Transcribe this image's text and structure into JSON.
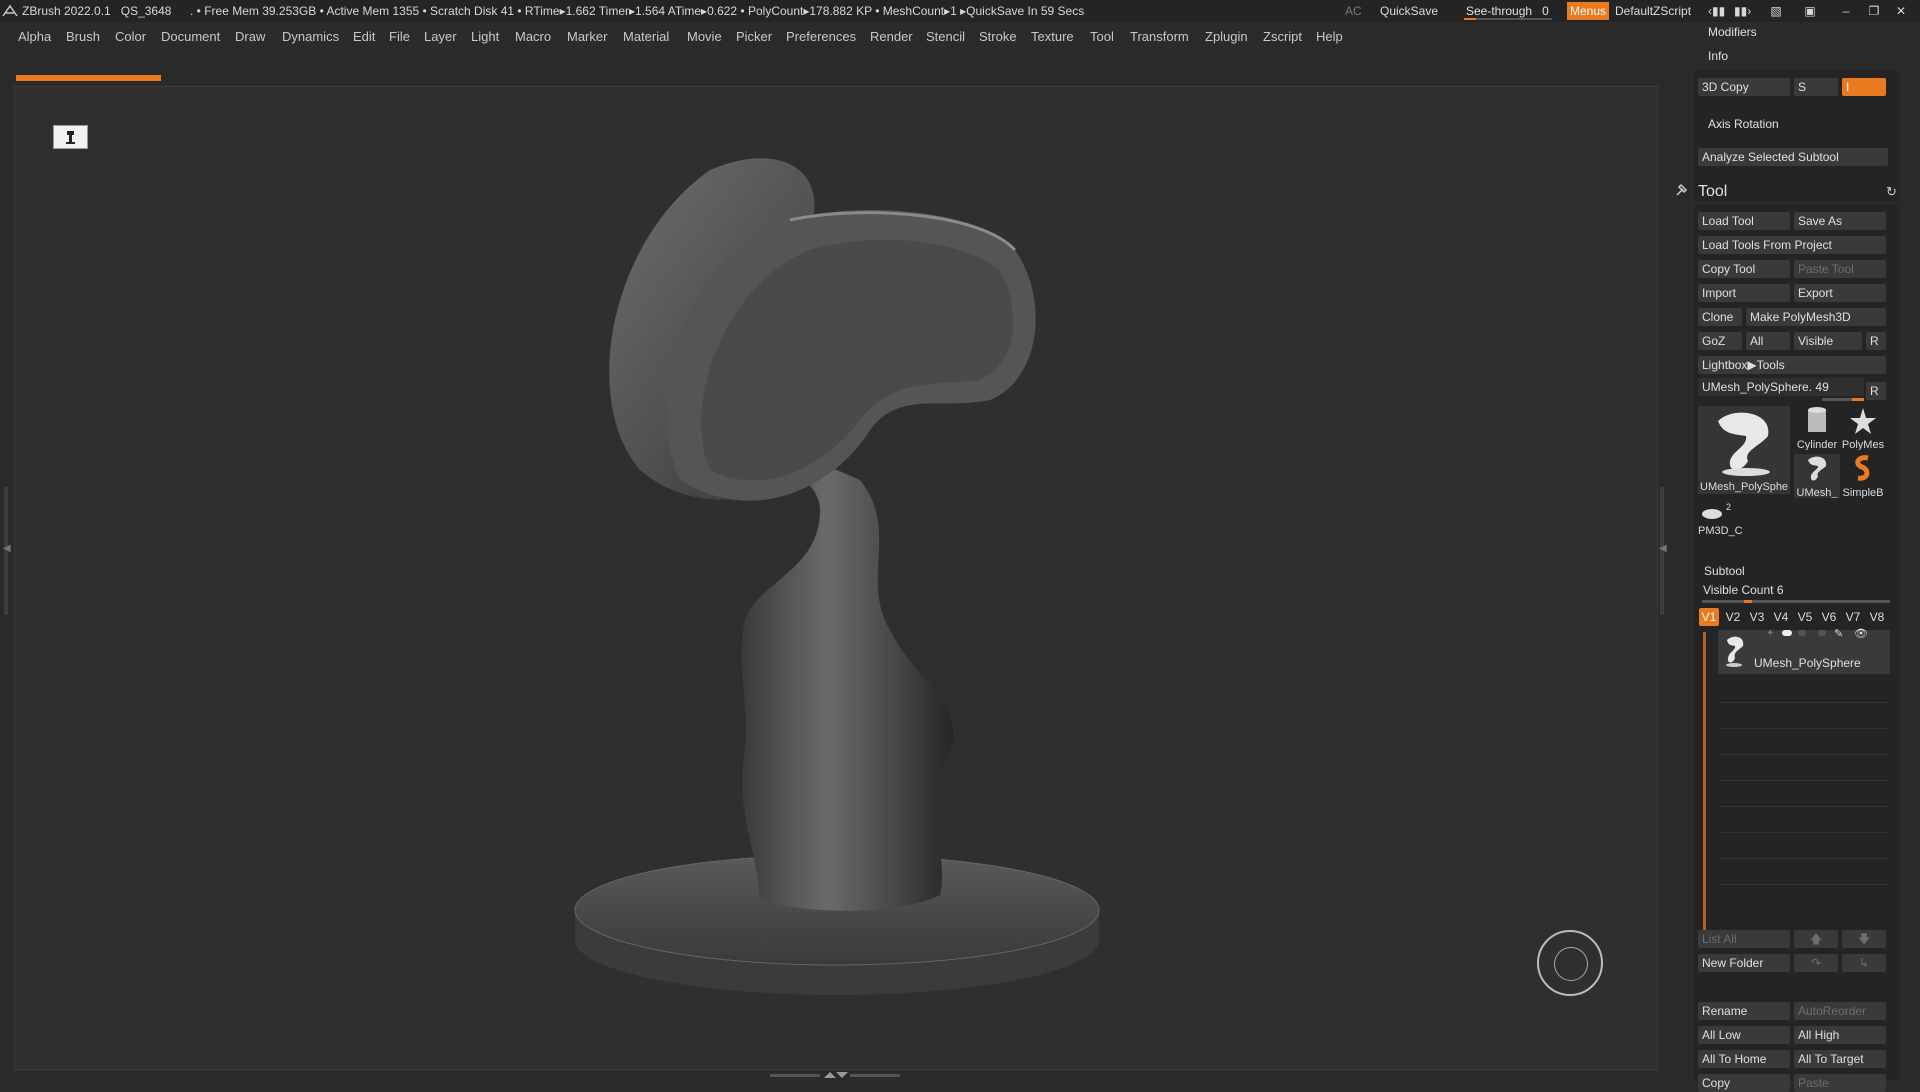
{
  "titlebar": {
    "app": "ZBrush 2022.0.1",
    "project": "QS_3648",
    "stats": ". • Free Mem 39.253GB • Active Mem 1355 • Scratch Disk 41 •  RTime▸1.662 Timer▸1.564 ATime▸0.622 • PolyCount▸178.882 KP  • MeshCount▸1  ▸QuickSave In 59 Secs",
    "ac": "AC",
    "quicksave": "QuickSave",
    "seethrough_label": "See-through",
    "seethrough_value": "0",
    "seethrough_level": 0.0,
    "menus": "Menus",
    "script": "DefaultZScript"
  },
  "menubar": [
    "Alpha",
    "Brush",
    "Color",
    "Document",
    "Draw",
    "Dynamics",
    "Edit",
    "File",
    "Layer",
    "Light",
    "Macro",
    "Marker",
    "Material",
    "Movie",
    "Picker",
    "Preferences",
    "Render",
    "Stencil",
    "Stroke",
    "Texture",
    "Tool",
    "Transform",
    "Zplugin",
    "Zscript",
    "Help"
  ],
  "panel": {
    "modifiers": "Modifiers",
    "info": "Info",
    "copy3d": "3D Copy",
    "s_label": "S",
    "i_label": "I",
    "axis_rotation": "Axis Rotation",
    "analyze": "Analyze Selected Subtool",
    "tool_title": "Tool",
    "tool_buttons": {
      "load_tool": "Load Tool",
      "save_as": "Save As",
      "load_from_project": "Load Tools From Project",
      "copy_tool": "Copy Tool",
      "paste_tool": "Paste Tool",
      "import": "Import",
      "export": "Export",
      "clone": "Clone",
      "make_polymesh": "Make PolyMesh3D",
      "goz": "GoZ",
      "all": "All",
      "visible": "Visible",
      "r": "R",
      "lightbox_tools": "Lightbox▶Tools"
    },
    "current_tool": "UMesh_PolySphere. 49",
    "current_tool_r": "R",
    "thumbs": [
      {
        "label": "UMesh_PolySphe"
      },
      {
        "label": "Cylinder"
      },
      {
        "label": "PolyMes"
      },
      {
        "label": "UMesh_"
      },
      {
        "label": "SimpleB"
      },
      {
        "label": "PM3D_C"
      }
    ],
    "thumb_badge": "2",
    "subtool": {
      "title": "Subtool",
      "visible_count": "Visible Count 6",
      "vtabs": [
        "V1",
        "V2",
        "V3",
        "V4",
        "V5",
        "V6",
        "V7",
        "V8"
      ],
      "item_name": "UMesh_PolySphere",
      "list_all": "List All",
      "new_folder": "New Folder",
      "rename": "Rename",
      "auto_reorder": "AutoReorder",
      "all_low": "All Low",
      "all_high": "All High",
      "all_to_home": "All To Home",
      "all_to_target": "All To Target",
      "copy": "Copy",
      "paste": "Paste"
    }
  },
  "colors": {
    "accent": "#e97a1f",
    "background": "#2a2a2a",
    "canvas": "#2f2f2f",
    "panel": "#2b2b2b"
  }
}
